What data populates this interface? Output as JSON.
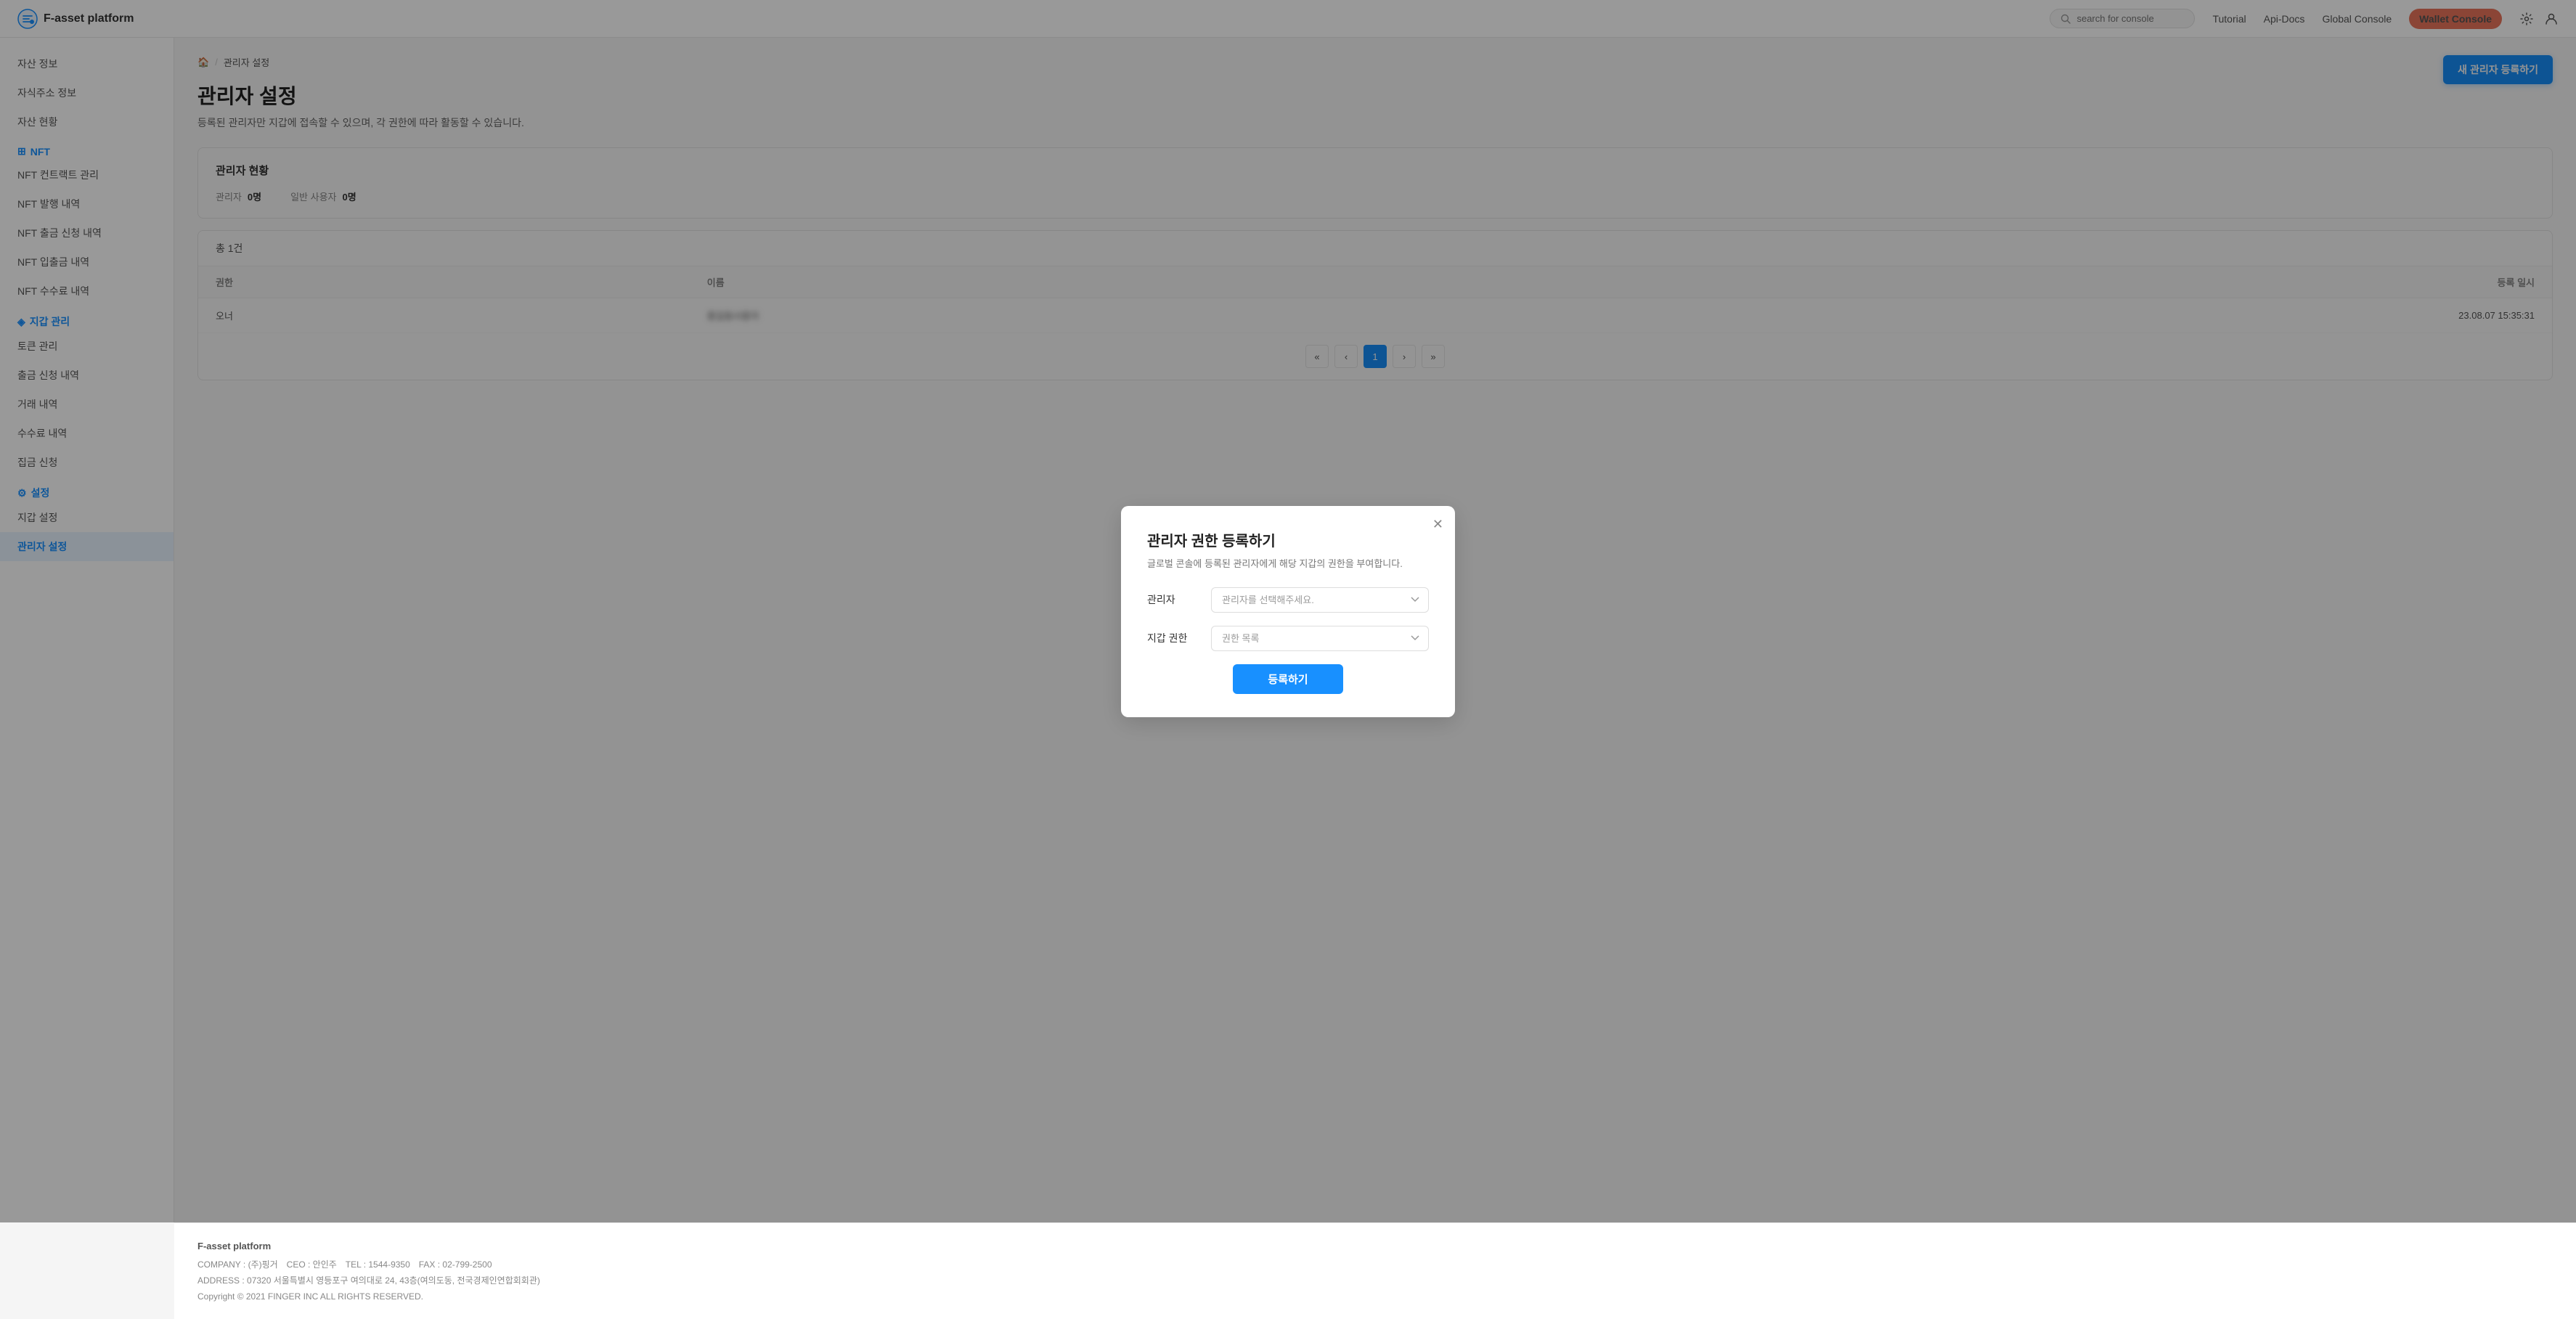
{
  "header": {
    "logo_text": "F-asset platform",
    "search_placeholder": "search for console",
    "nav": [
      {
        "label": "Tutorial",
        "active": false
      },
      {
        "label": "Api-Docs",
        "active": false
      },
      {
        "label": "Global Console",
        "active": false
      },
      {
        "label": "Wallet Console",
        "active": true
      }
    ]
  },
  "sidebar": {
    "top_items": [
      {
        "label": "자산 정보",
        "active": false
      },
      {
        "label": "자식주소 정보",
        "active": false
      },
      {
        "label": "자산 현황",
        "active": false
      }
    ],
    "sections": [
      {
        "label": "NFT",
        "icon": "nft",
        "items": [
          {
            "label": "NFT 컨트랙트 관리",
            "active": false
          },
          {
            "label": "NFT 발행 내역",
            "active": false
          },
          {
            "label": "NFT 출금 신청 내역",
            "active": false
          },
          {
            "label": "NFT 입출금 내역",
            "active": false
          },
          {
            "label": "NFT 수수료 내역",
            "active": false
          }
        ]
      },
      {
        "label": "지갑 관리",
        "icon": "wallet",
        "items": [
          {
            "label": "토큰 관리",
            "active": false
          },
          {
            "label": "출금 신청 내역",
            "active": false
          },
          {
            "label": "거래 내역",
            "active": false
          },
          {
            "label": "수수료 내역",
            "active": false
          },
          {
            "label": "집금 신청",
            "active": false
          }
        ]
      },
      {
        "label": "설정",
        "icon": "settings",
        "items": [
          {
            "label": "지갑 설정",
            "active": false
          },
          {
            "label": "관리자 설정",
            "active": true
          }
        ]
      }
    ]
  },
  "breadcrumb": {
    "home_icon": "🏠",
    "separator": "/",
    "current": "관리자 설정"
  },
  "page": {
    "title": "관리자 설정",
    "description": "등록된 관리자만 지갑에 접속할 수 있으며, 각 권한에 따라 활동할 수 있습니다.",
    "new_admin_btn": "새 관리자 등록하기",
    "admin_status": {
      "label": "관리자 현황",
      "admin_label": "관리자",
      "admin_count": "0명",
      "general_user_label": "일반 사용자",
      "general_user_count": "0명"
    },
    "table": {
      "total_label": "총 1건",
      "columns": [
        "권한",
        "이름",
        "등록 일시"
      ],
      "rows": [
        {
          "role": "오너",
          "name": "BLURRED",
          "date": "23.08.07 15:35:31"
        }
      ]
    },
    "pagination": {
      "pages": [
        1
      ],
      "current": 1
    }
  },
  "modal": {
    "title": "관리자 권한 등록하기",
    "description": "글로벌 콘솔에 등록된 관리자에게 해당 지갑의 권한을 부여합니다.",
    "admin_label": "관리자",
    "admin_placeholder": "관리자를 선택해주세요.",
    "wallet_auth_label": "지갑 권한",
    "wallet_auth_placeholder": "권한 목록",
    "submit_btn": "등록하기"
  },
  "footer": {
    "company": "F-asset platform",
    "company_info": "COMPANY : (주)핑거　CEO : 안인주　TEL : 1544-9350　FAX : 02-799-2500",
    "address": "ADDRESS : 07320 서울특별시 영등포구 여의대로 24, 43층(여의도동, 전국경제인연합회회관)",
    "copyright": "Copyright © 2021 FINGER INC ALL RIGHTS RESERVED."
  }
}
